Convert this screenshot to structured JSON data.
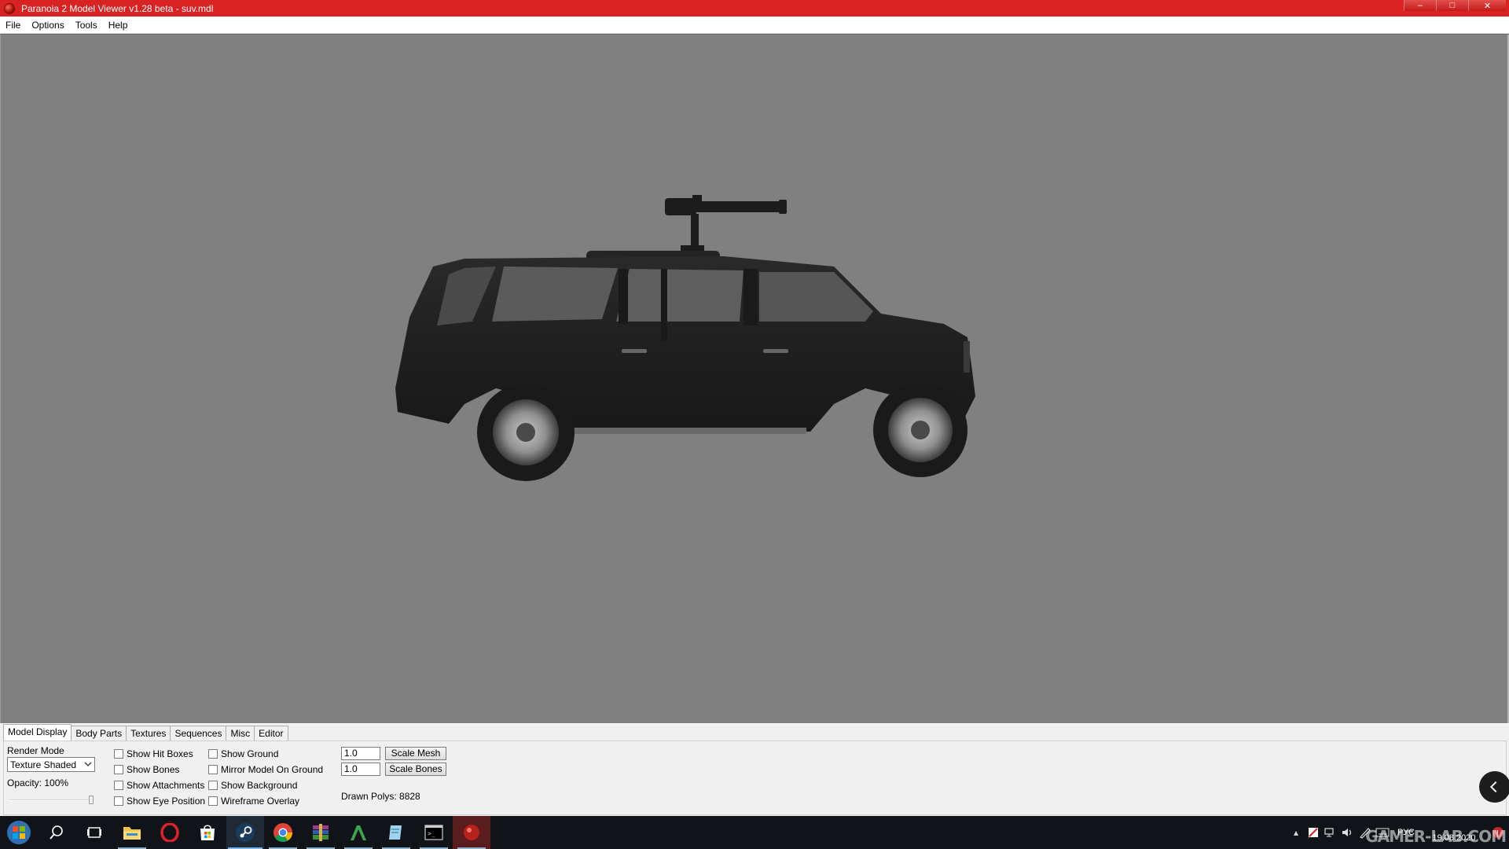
{
  "window": {
    "title": "Paranoia 2 Model Viewer v1.28 beta - suv.mdl",
    "controls": {
      "minimize": "–",
      "maximize": "□",
      "close": "✕"
    }
  },
  "menu": {
    "file": "File",
    "options": "Options",
    "tools": "Tools",
    "help": "Help"
  },
  "tabs": [
    "Model Display",
    "Body Parts",
    "Textures",
    "Sequences",
    "Misc",
    "Editor"
  ],
  "model_display": {
    "render_mode_label": "Render Mode",
    "render_mode_value": "Texture Shaded",
    "opacity_label": "Opacity: 100%",
    "opacity_value_percent": 100,
    "checkboxes_col1": [
      "Show Hit Boxes",
      "Show Bones",
      "Show Attachments",
      "Show Eye Position"
    ],
    "checkboxes_col2": [
      "Show Ground",
      "Mirror Model On Ground",
      "Show Background",
      "Wireframe Overlay"
    ],
    "scale_mesh_value": "1.0",
    "scale_mesh_button": "Scale Mesh",
    "scale_bones_value": "1.0",
    "scale_bones_button": "Scale Bones",
    "drawn_polys": "Drawn Polys: 8828"
  },
  "taskbar": {
    "apps": [
      "start-button",
      "search-icon",
      "task-view-icon",
      "file-explorer-icon",
      "opera-icon",
      "store-icon",
      "steam-icon",
      "chrome-icon",
      "winrar-icon",
      "app-green-icon",
      "notepad-icon",
      "terminal-icon",
      "model-viewer-icon"
    ],
    "language": "РУС",
    "date": "19.08.2020",
    "watermark": "GAMER-LAB.COM"
  },
  "colors": {
    "titlebar": "#d92322",
    "viewport_bg": "#808080",
    "panel_bg": "#f0f0f0",
    "taskbar": "#101418"
  }
}
